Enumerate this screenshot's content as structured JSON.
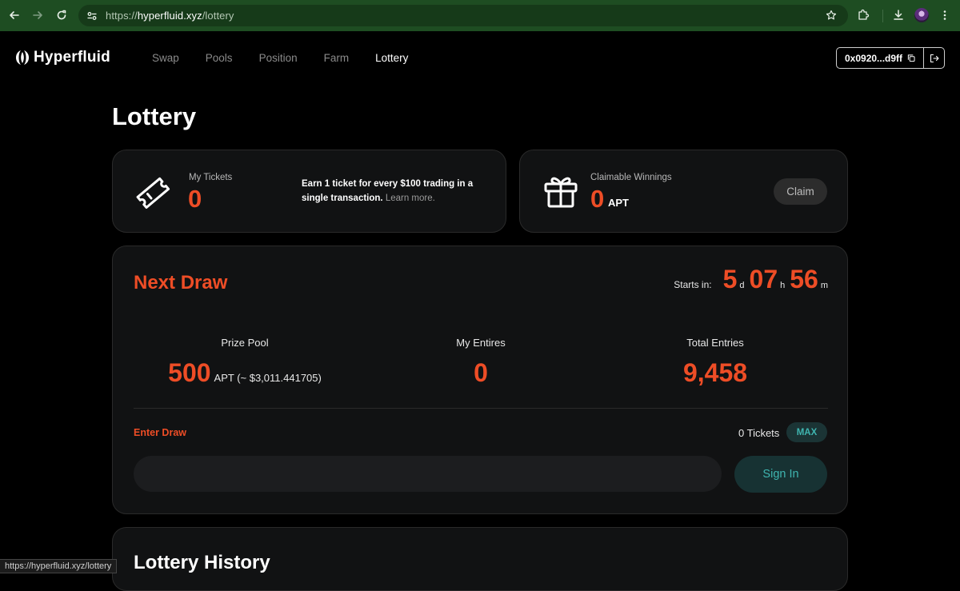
{
  "browser": {
    "url_scheme": "https://",
    "url_host": "hyperfluid.xyz",
    "url_path": "/lottery",
    "status_url": "https://hyperfluid.xyz/lottery"
  },
  "header": {
    "brand": "Hyperfluid",
    "nav": [
      {
        "label": "Swap",
        "active": false
      },
      {
        "label": "Pools",
        "active": false
      },
      {
        "label": "Position",
        "active": false
      },
      {
        "label": "Farm",
        "active": false
      },
      {
        "label": "Lottery",
        "active": true
      }
    ],
    "wallet_address": "0x0920...d9ff"
  },
  "page": {
    "title": "Lottery"
  },
  "tickets": {
    "label": "My Tickets",
    "value": "0",
    "earn_text": "Earn 1 ticket for every $100 trading in a single transaction.",
    "learn_more": "Learn more."
  },
  "winnings": {
    "label": "Claimable Winnings",
    "value": "0",
    "unit": "APT",
    "claim_label": "Claim"
  },
  "draw": {
    "title": "Next Draw",
    "starts_label": "Starts in:",
    "days": "5",
    "days_unit": "d",
    "hours": "07",
    "hours_unit": "h",
    "minutes": "56",
    "minutes_unit": "m",
    "prize_pool_label": "Prize Pool",
    "prize_pool_value": "500",
    "prize_pool_suffix": "APT (~ $3,011.441705)",
    "my_entries_label": "My Entires",
    "my_entries_value": "0",
    "total_entries_label": "Total Entries",
    "total_entries_value": "9,458",
    "enter_label": "Enter Draw",
    "tickets_available": "0 Tickets",
    "max_label": "MAX",
    "input_value": "",
    "input_placeholder": "",
    "sign_in_label": "Sign In"
  },
  "history": {
    "title": "Lottery History"
  },
  "colors": {
    "accent": "#ee4d26",
    "teal": "#3fb5b0",
    "chrome_green": "#1e4d22"
  }
}
